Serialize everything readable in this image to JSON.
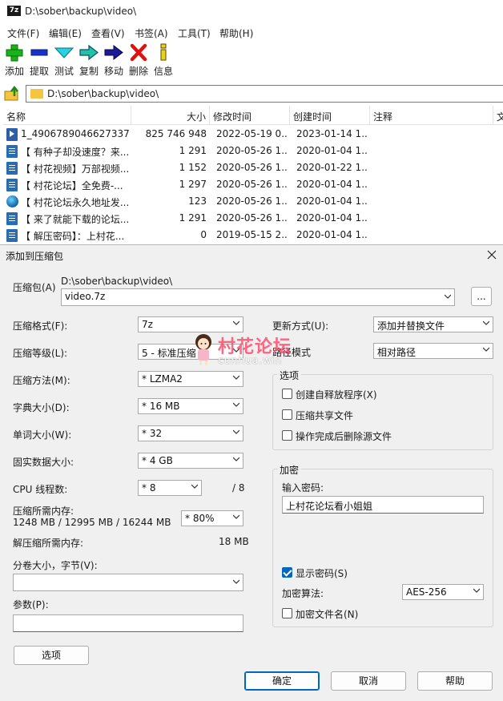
{
  "window": {
    "app_icon_text": "7z",
    "title": "D:\\sober\\backup\\video\\"
  },
  "menu": [
    "文件(F)",
    "编辑(E)",
    "查看(V)",
    "书签(A)",
    "工具(T)",
    "帮助(H)"
  ],
  "toolbar": {
    "add": "添加",
    "extract": "提取",
    "test": "测试",
    "copy": "复制",
    "move": "移动",
    "delete": "删除",
    "info": "信息"
  },
  "address": "D:\\sober\\backup\\video\\",
  "file_list": {
    "columns": [
      "名称",
      "大小",
      "修改时间",
      "创建时间",
      "注释",
      "文"
    ],
    "rows": [
      {
        "icon": "mp4-icon",
        "name": "1_4906789046627337...",
        "size": "825 746 948",
        "modified": "2022-05-19 0...",
        "created": "2023-01-14 1..."
      },
      {
        "icon": "doc-icon",
        "name": "【 有种子却没速度？来...",
        "size": "1 291",
        "modified": "2020-05-26 1...",
        "created": "2020-01-04 1..."
      },
      {
        "icon": "doc-icon",
        "name": "【 村花视频】万部视频...",
        "size": "1 152",
        "modified": "2020-05-26 1...",
        "created": "2020-01-22 1..."
      },
      {
        "icon": "doc-icon",
        "name": "【 村花论坛】全免费-...",
        "size": "1 297",
        "modified": "2020-05-26 1...",
        "created": "2020-01-04 1..."
      },
      {
        "icon": "globe-icon",
        "name": "【 村花论坛永久地址发...",
        "size": "123",
        "modified": "2020-05-26 1...",
        "created": "2020-01-04 1..."
      },
      {
        "icon": "doc-icon",
        "name": "【 来了就能下载的论坛...",
        "size": "1 291",
        "modified": "2020-05-26 1...",
        "created": "2020-01-04 1..."
      },
      {
        "icon": "doc-icon",
        "name": "【 解压密码】：上村花...",
        "size": "0",
        "modified": "2019-05-15 2...",
        "created": "2020-01-04 1..."
      }
    ]
  },
  "dialog": {
    "title": "添加到压缩包",
    "archive_label": "压缩包(A)",
    "archive_path": "D:\\sober\\backup\\video\\",
    "archive_name": "video.7z",
    "browse": "...",
    "format_label": "压缩格式(F):",
    "format_value": "7z",
    "level_label": "压缩等级(L):",
    "level_value": "5 - 标准压缩",
    "method_label": "压缩方法(M):",
    "method_value": "* LZMA2",
    "dict_label": "字典大小(D):",
    "dict_value": "* 16 MB",
    "word_label": "单词大小(W):",
    "word_value": "* 32",
    "solid_label": "固实数据大小:",
    "solid_value": "* 4 GB",
    "cpu_label": "CPU 线程数:",
    "cpu_value": "* 8",
    "cpu_max": "/ 8",
    "mem_label": "压缩所需内存:",
    "mem_values": "1248 MB / 12995 MB / 16244 MB",
    "mem_percent": "* 80%",
    "decomp_label": "解压缩所需内存:",
    "decomp_value": "18 MB",
    "volume_label": "分卷大小，字节(V):",
    "volume_value": "",
    "params_label": "参数(P):",
    "params_value": "",
    "options_button": "选项",
    "update_label": "更新方式(U):",
    "update_value": "添加并替换文件",
    "pathmode_label": "路径模式",
    "pathmode_value": "相对路径",
    "options_group": "选项",
    "opt_sfx": "创建自释放程序(X)",
    "opt_shared": "压缩共享文件",
    "opt_delete": "操作完成后删除源文件",
    "encrypt_group": "加密",
    "password_label": "输入密码:",
    "password_value": "上村花论坛看小姐姐",
    "show_password": "显示密码(S)",
    "show_password_checked": true,
    "encrypt_method_label": "加密算法:",
    "encrypt_method_value": "AES-256",
    "encrypt_names": "加密文件名(N)",
    "ok": "确定",
    "cancel": "取消",
    "help": "帮助"
  },
  "watermark": {
    "text": "村花论坛",
    "sub": "cunhua.win"
  },
  "colors": {
    "accent": "#0067c0",
    "watermark": "#ff4d6d"
  }
}
